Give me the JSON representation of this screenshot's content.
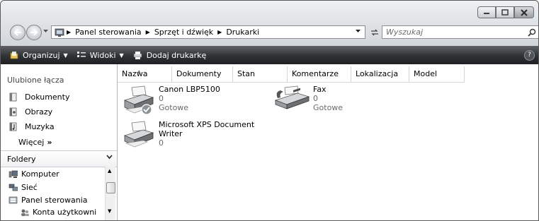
{
  "breadcrumb": [
    "Panel sterowania",
    "Sprzęt i dźwięk",
    "Drukarki"
  ],
  "search": {
    "placeholder": "Wyszukaj"
  },
  "toolbar": {
    "organize_label": "Organizuj",
    "views_label": "Widoki",
    "add_printer_label": "Dodaj drukarkę",
    "help_label": "?"
  },
  "sidebar": {
    "favorites_title": "Ulubione łącza",
    "favorites": [
      "Dokumenty",
      "Obrazy",
      "Muzyka"
    ],
    "more_label": "Więcej",
    "more_chevron": "»",
    "folders_title": "Foldery",
    "tree": [
      "Komputer",
      "Sieć",
      "Panel sterowania",
      "Konta użytkowni"
    ]
  },
  "columns": [
    "Nazwa",
    "Dokumenty",
    "Stan",
    "Komentarze",
    "Lokalizacja",
    "Model"
  ],
  "printers": [
    {
      "name": "Canon LBP5100",
      "documents": "0",
      "status": "Gotowe",
      "is_default": true
    },
    {
      "name": "Fax",
      "documents": "0",
      "status": "Gotowe",
      "is_default": false
    },
    {
      "name_line1": "Microsoft XPS Document",
      "name_line2": "Writer",
      "documents": "0",
      "status": "",
      "is_default": false
    }
  ],
  "icons": {
    "back": "back-arrow-icon",
    "forward": "forward-arrow-icon",
    "control_panel": "control-panel-icon",
    "refresh": "refresh-icon",
    "search": "search-icon",
    "organize": "organize-icon",
    "views": "views-icon",
    "add_printer": "add-printer-icon",
    "printer": "printer-icon",
    "fax": "fax-icon",
    "default_check": "default-check-icon"
  },
  "colors": {
    "toolbar_top": "#5e6266",
    "toolbar_bottom": "#1e2023",
    "window_chrome": "#cfd4d8"
  }
}
